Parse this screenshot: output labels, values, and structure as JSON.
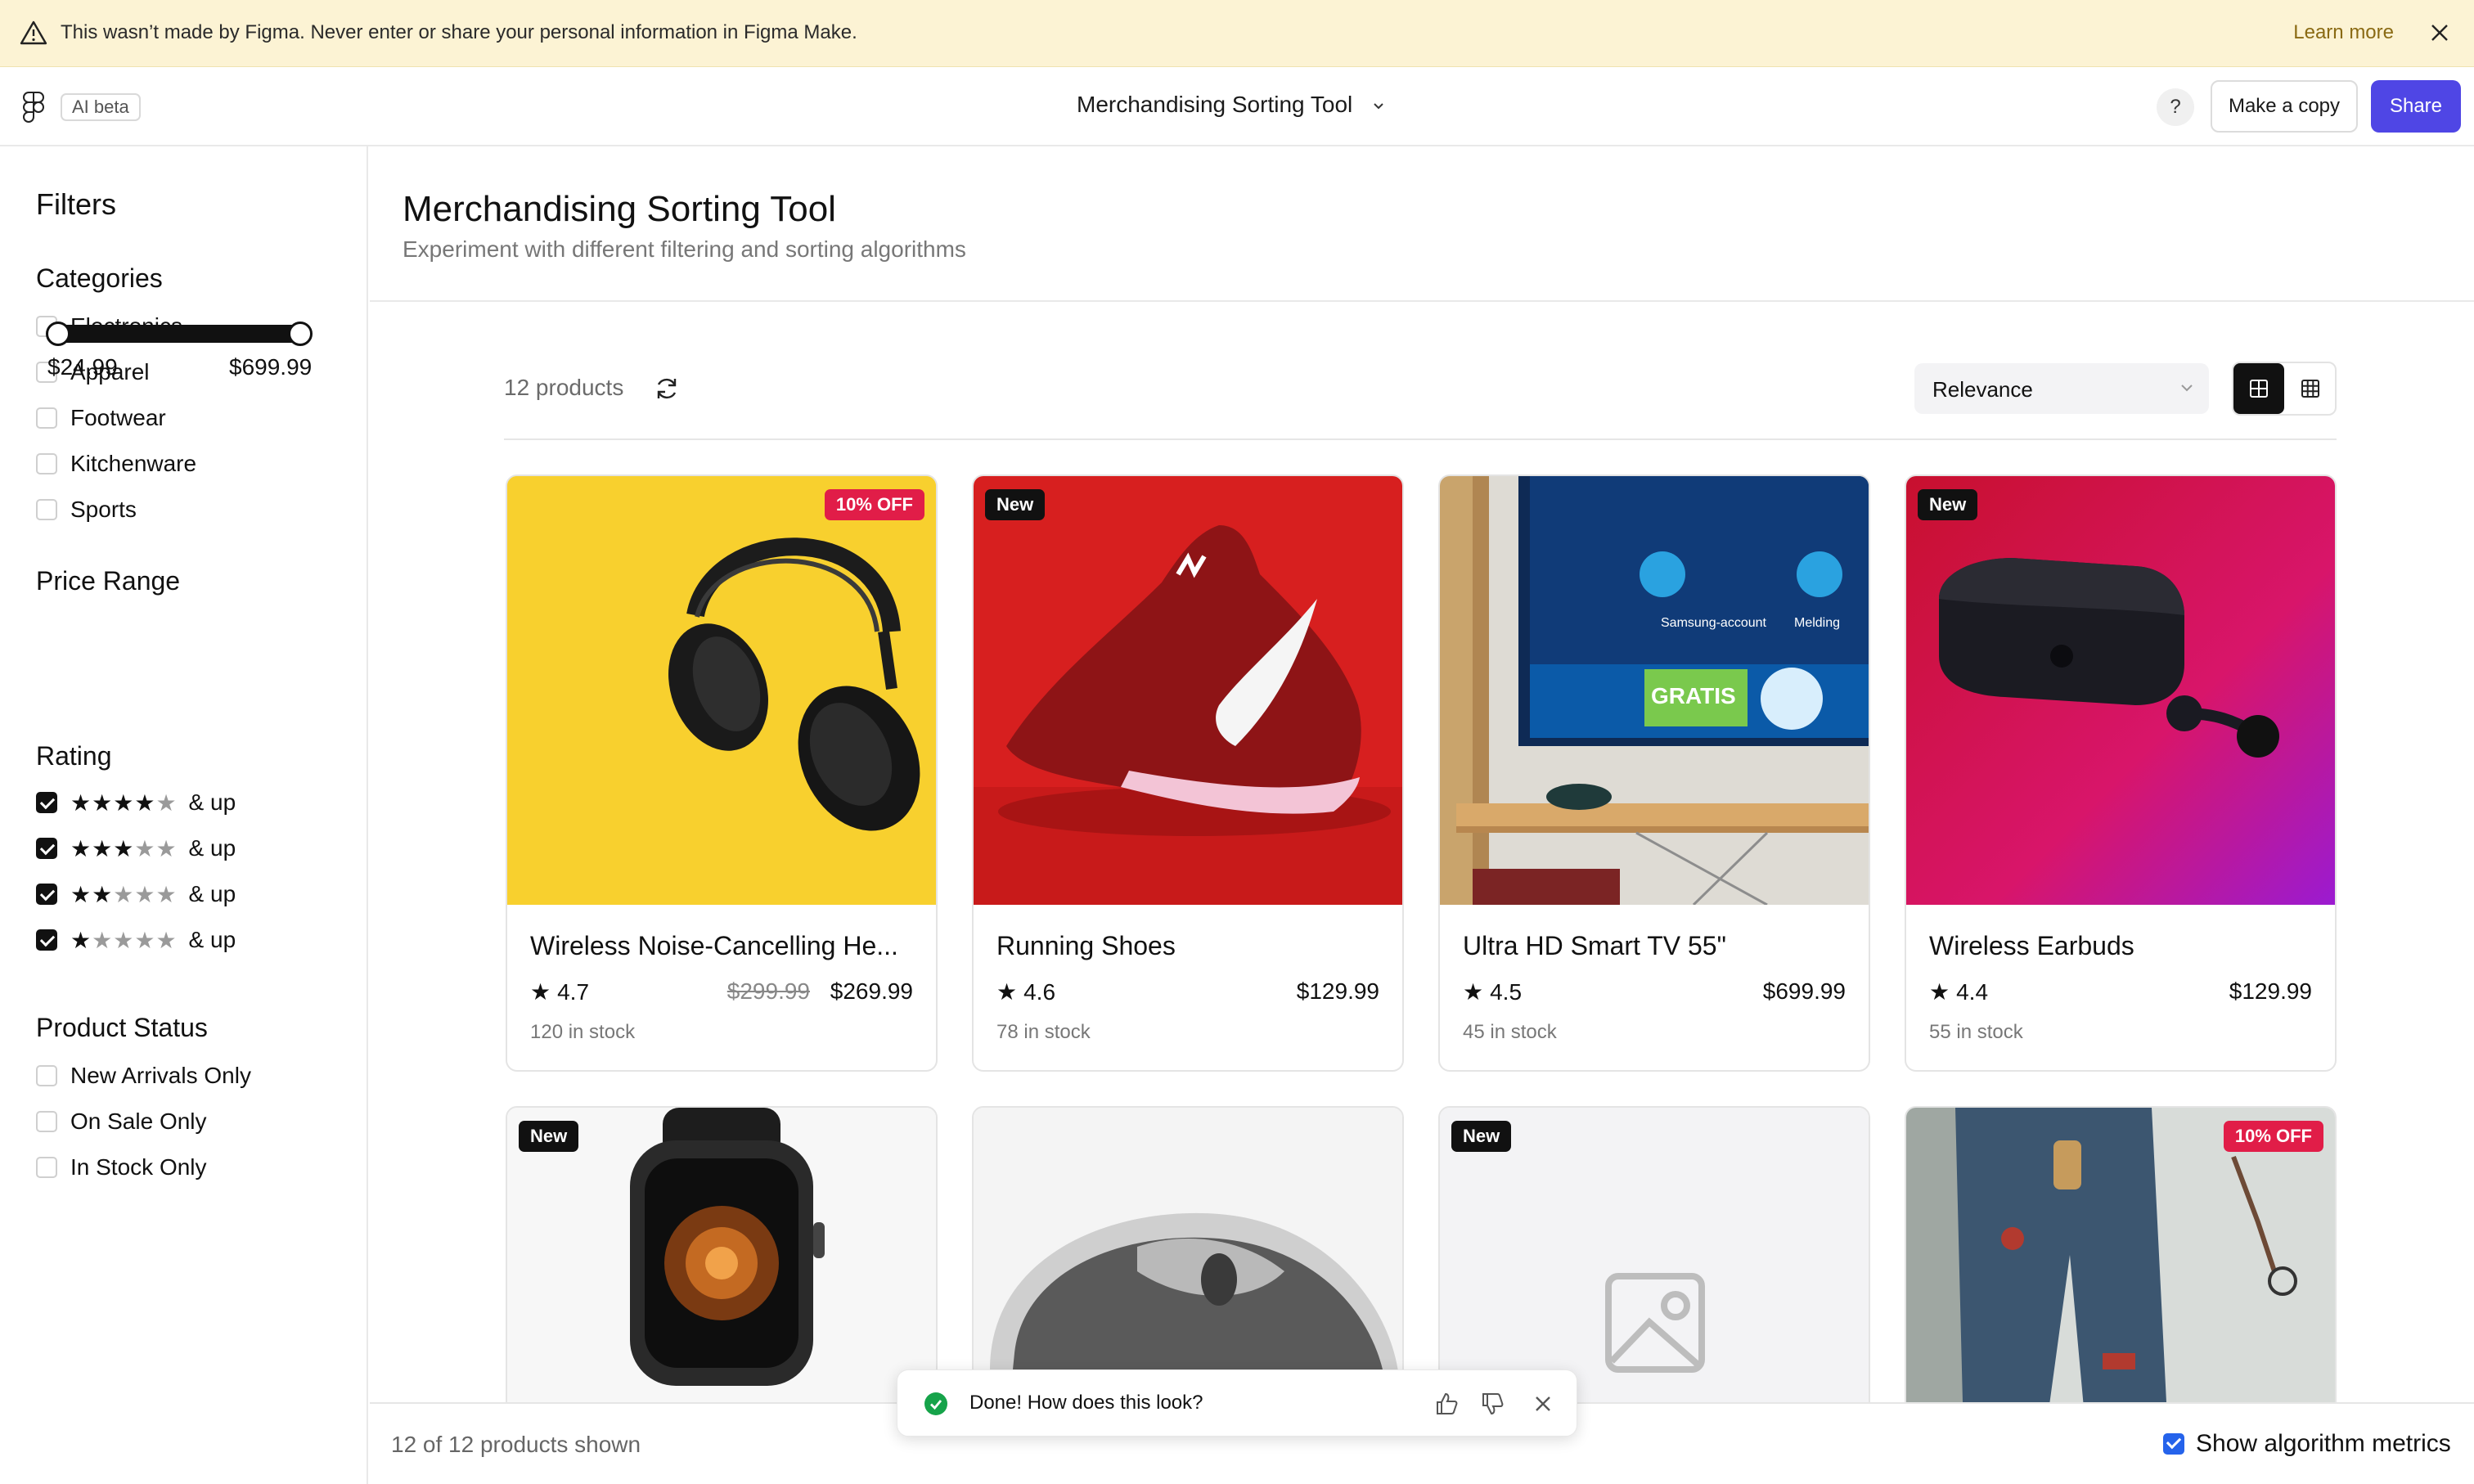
{
  "banner": {
    "message": "This wasn’t made by Figma. Never enter or share your personal information in Figma Make.",
    "learn_more": "Learn more"
  },
  "topbar": {
    "ai_badge": "AI beta",
    "file_title": "Merchandising Sorting Tool",
    "help": "?",
    "make_copy": "Make a copy",
    "share": "Share"
  },
  "sidebar": {
    "title": "Filters",
    "categories_title": "Categories",
    "categories": [
      "Electronics",
      "Apparel",
      "Footwear",
      "Kitchenware",
      "Sports"
    ],
    "price_title": "Price Range",
    "price_min": "$24.99",
    "price_max": "$699.99",
    "price_slider_low_fraction": 0,
    "price_slider_high_fraction": 1,
    "rating_title": "Rating",
    "rating_suffix": "& up",
    "rating_options": [
      {
        "stars": 4,
        "checked": true
      },
      {
        "stars": 3,
        "checked": true
      },
      {
        "stars": 2,
        "checked": true
      },
      {
        "stars": 1,
        "checked": true
      }
    ],
    "status_title": "Product Status",
    "status_options": [
      "New Arrivals Only",
      "On Sale Only",
      "In Stock Only"
    ]
  },
  "main": {
    "title": "Merchandising Sorting Tool",
    "subtitle": "Experiment with different filtering and sorting algorithms",
    "product_count": "12 products",
    "sort_value": "Relevance"
  },
  "products": [
    {
      "name": "Wireless Noise-Cancelling He...",
      "rating": "4.7",
      "old_price": "$299.99",
      "price": "$269.99",
      "stock": "120 in stock",
      "badge": "10% OFF",
      "image": "headphones"
    },
    {
      "name": "Running Shoes",
      "rating": "4.6",
      "price": "$129.99",
      "stock": "78 in stock",
      "badge": "New",
      "image": "shoe"
    },
    {
      "name": "Ultra HD Smart TV 55\"",
      "rating": "4.5",
      "price": "$699.99",
      "stock": "45 in stock",
      "image": "tv"
    },
    {
      "name": "Wireless Earbuds",
      "rating": "4.4",
      "price": "$129.99",
      "stock": "55 in stock",
      "badge": "New",
      "image": "earbuds"
    },
    {
      "badge": "New",
      "image": "watch"
    },
    {
      "image": "mouse"
    },
    {
      "badge": "New",
      "image": "placeholder"
    },
    {
      "badge": "10% OFF",
      "image": "jeans"
    }
  ],
  "tv_screen": {
    "account": "Samsung-account",
    "notify": "Melding",
    "promo": "GRATIS"
  },
  "footer": {
    "shown": "12 of 12 products shown",
    "metrics_label": "Show algorithm metrics",
    "metrics_checked": true
  },
  "toast": {
    "message": "Done! How does this look?"
  },
  "colors": {
    "accent": "#4f46e5",
    "sale_badge": "#e11d48",
    "banner_bg": "#fcf3d4",
    "success": "#16a34a"
  }
}
